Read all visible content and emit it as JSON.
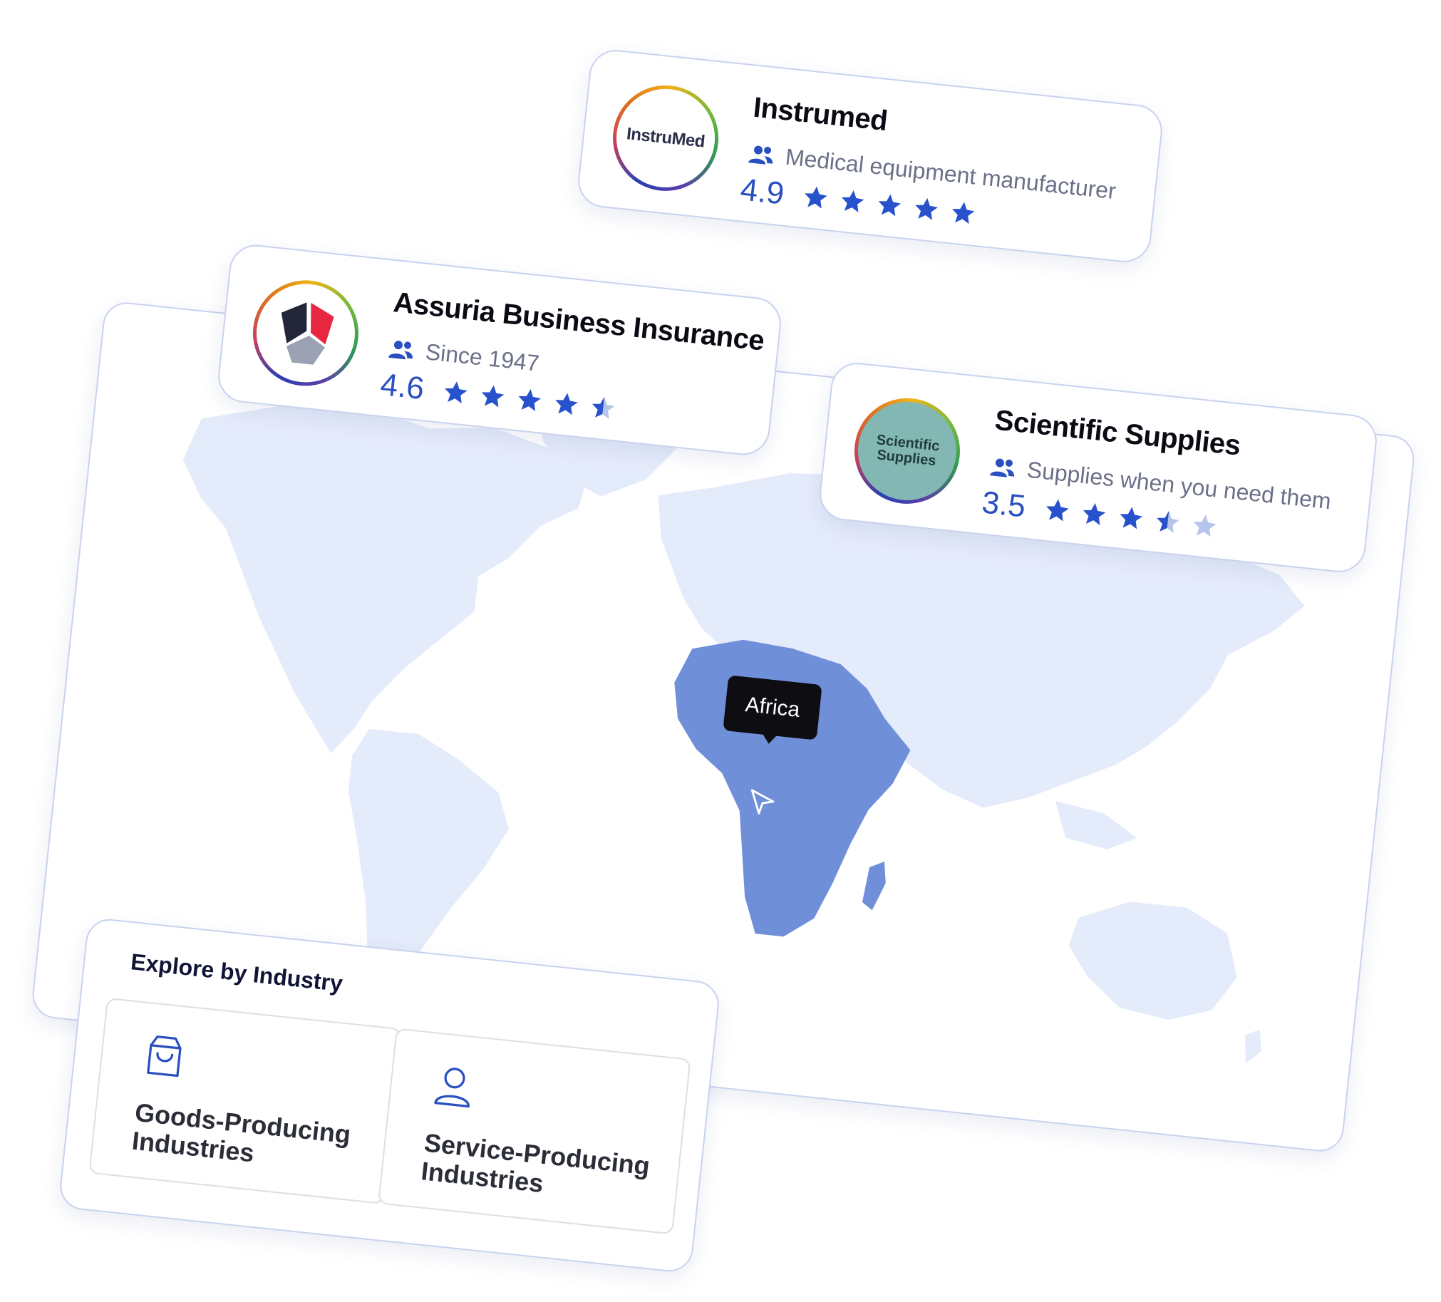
{
  "cards": {
    "instrumed": {
      "logo_text": "InstruMed",
      "name": "Instrumed",
      "subtitle": "Medical equipment manufacturer",
      "rating": "4.9",
      "stars": 4.9
    },
    "assuria": {
      "name": "Assuria Business Insurance",
      "subtitle": "Since 1947",
      "rating": "4.6",
      "stars": 4.6
    },
    "scientific": {
      "logo_text_1": "Scientific",
      "logo_text_2": "Supplies",
      "name": "Scientific Supplies",
      "subtitle": "Supplies when you need them",
      "rating": "3.5",
      "stars": 3.5
    }
  },
  "map": {
    "tooltip": "Africa"
  },
  "explore": {
    "title": "Explore by Industry",
    "industries": [
      {
        "label": "Goods-Producing Industries",
        "icon": "shopping-bag-icon"
      },
      {
        "label": "Service-Producing Industries",
        "icon": "user-icon"
      }
    ]
  },
  "colors": {
    "accent": "#2a4fbf",
    "star_filled": "#2851cc",
    "star_empty": "#b6c4ec",
    "land": "#e4ebfa",
    "land_selected": "#6f8fd8",
    "card_border": "#c9d3f0"
  }
}
